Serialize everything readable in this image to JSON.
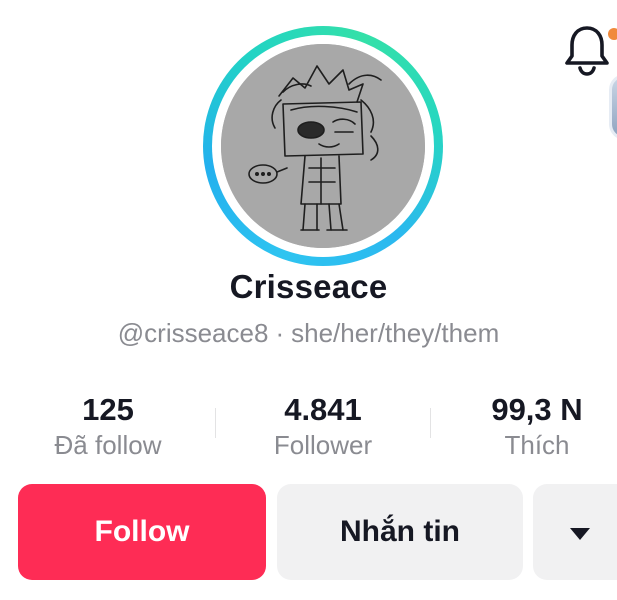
{
  "header": {
    "notifications_icon": "bell-icon",
    "notification_dot_color": "#f08a3c"
  },
  "profile": {
    "avatar_ring_colors": [
      "#2ec4f0",
      "#34e0a8"
    ],
    "display_name": "Crisseace",
    "username": "@crisseace8",
    "separator": "·",
    "pronouns": "she/her/they/them"
  },
  "stats": [
    {
      "value": "125",
      "label": "Đã follow"
    },
    {
      "value": "4.841",
      "label": "Follower"
    },
    {
      "value": "99,3 N",
      "label": "Thích"
    }
  ],
  "actions": {
    "follow_label": "Follow",
    "follow_color": "#fe2c55",
    "message_label": "Nhắn tin",
    "more_icon": "caret-down-icon"
  }
}
